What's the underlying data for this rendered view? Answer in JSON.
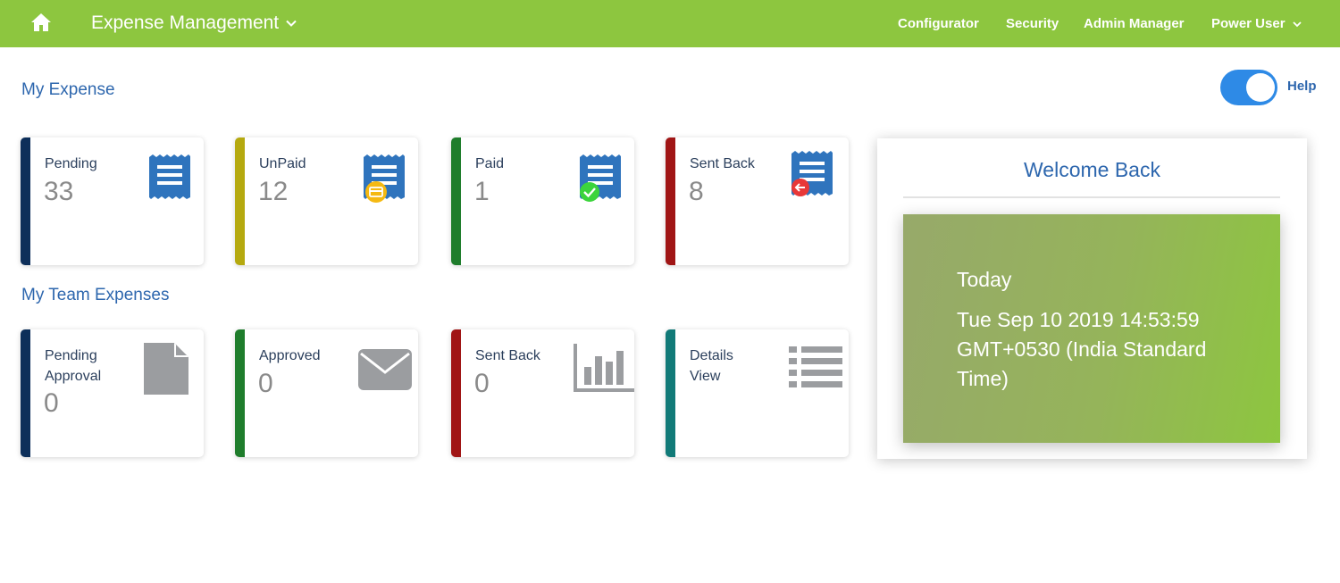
{
  "header": {
    "app_title": "Expense Management",
    "nav": {
      "configurator": "Configurator",
      "security": "Security",
      "admin_manager": "Admin Manager",
      "user": "Power User"
    }
  },
  "help": {
    "label": "Help",
    "enabled": true
  },
  "my_expense": {
    "title": "My Expense",
    "cards": [
      {
        "label": "Pending",
        "count": "33",
        "accent": "#0d2f5a",
        "icon": "receipt-icon"
      },
      {
        "label": "UnPaid",
        "count": "12",
        "accent": "#b5a90f",
        "icon": "receipt-unpaid-icon"
      },
      {
        "label": "Paid",
        "count": "1",
        "accent": "#1f7d2c",
        "icon": "receipt-paid-icon"
      },
      {
        "label": "Sent Back",
        "count": "8",
        "accent": "#a01515",
        "icon": "receipt-sent-back-icon"
      }
    ]
  },
  "my_team": {
    "title": "My Team Expenses",
    "cards": [
      {
        "label": "Pending Approval",
        "count": "0",
        "accent": "#0d2f5a",
        "icon": "document-icon"
      },
      {
        "label": "Approved",
        "count": "0",
        "accent": "#1f7d2c",
        "icon": "envelope-icon"
      },
      {
        "label": "Sent Back",
        "count": "0",
        "accent": "#a01515",
        "icon": "bar-chart-icon"
      },
      {
        "label": "Details View",
        "count": "",
        "accent": "#117a78",
        "icon": "list-icon"
      }
    ]
  },
  "welcome": {
    "title": "Welcome Back",
    "today_label": "Today",
    "today_value": "Tue Sep 10 2019 14:53:59 GMT+0530 (India Standard Time)"
  },
  "colors": {
    "topbar": "#8dc63f",
    "accent_blue": "#2e67ae",
    "icon_blue": "#2f74bd",
    "icon_gray": "#9b9da0"
  }
}
